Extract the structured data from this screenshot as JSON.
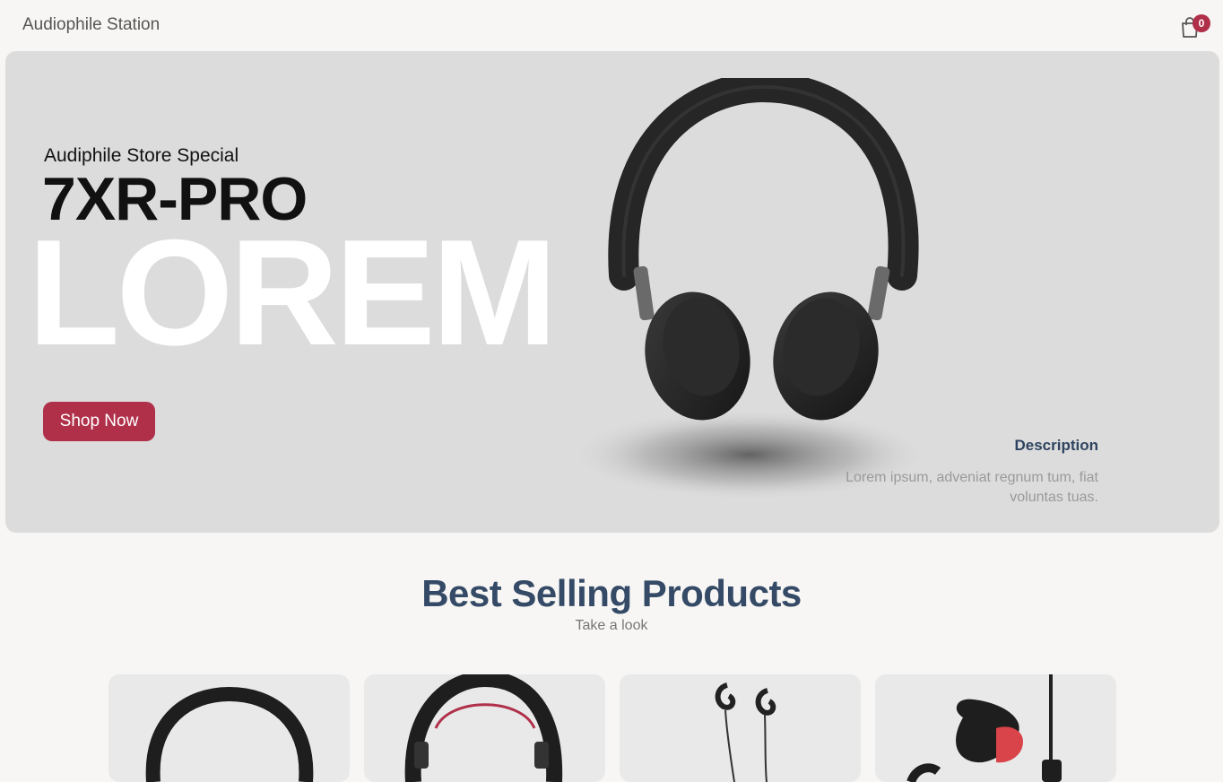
{
  "header": {
    "brand": "Audiophile Station",
    "cart_count": "0",
    "cart_icon": "shopping-bag-icon"
  },
  "hero": {
    "subtitle": "Audiphile Store Special",
    "title": "7XR-PRO",
    "background_word": "LOREM",
    "cta_label": "Shop Now",
    "description_title": "Description",
    "description_text": "Lorem ipsum, adveniat regnum tum, fiat voluntas tuas."
  },
  "products_section": {
    "title": "Best Selling Products",
    "subtitle": "Take a look",
    "products": [
      {
        "icon": "over-ear-headphones-icon"
      },
      {
        "icon": "gaming-headset-icon"
      },
      {
        "icon": "wired-earphones-icon"
      },
      {
        "icon": "sport-earbuds-icon"
      }
    ]
  },
  "colors": {
    "accent": "#b0304a",
    "heading": "#344a66",
    "hero_bg": "#dcdcdc",
    "page_bg": "#f7f6f4"
  }
}
